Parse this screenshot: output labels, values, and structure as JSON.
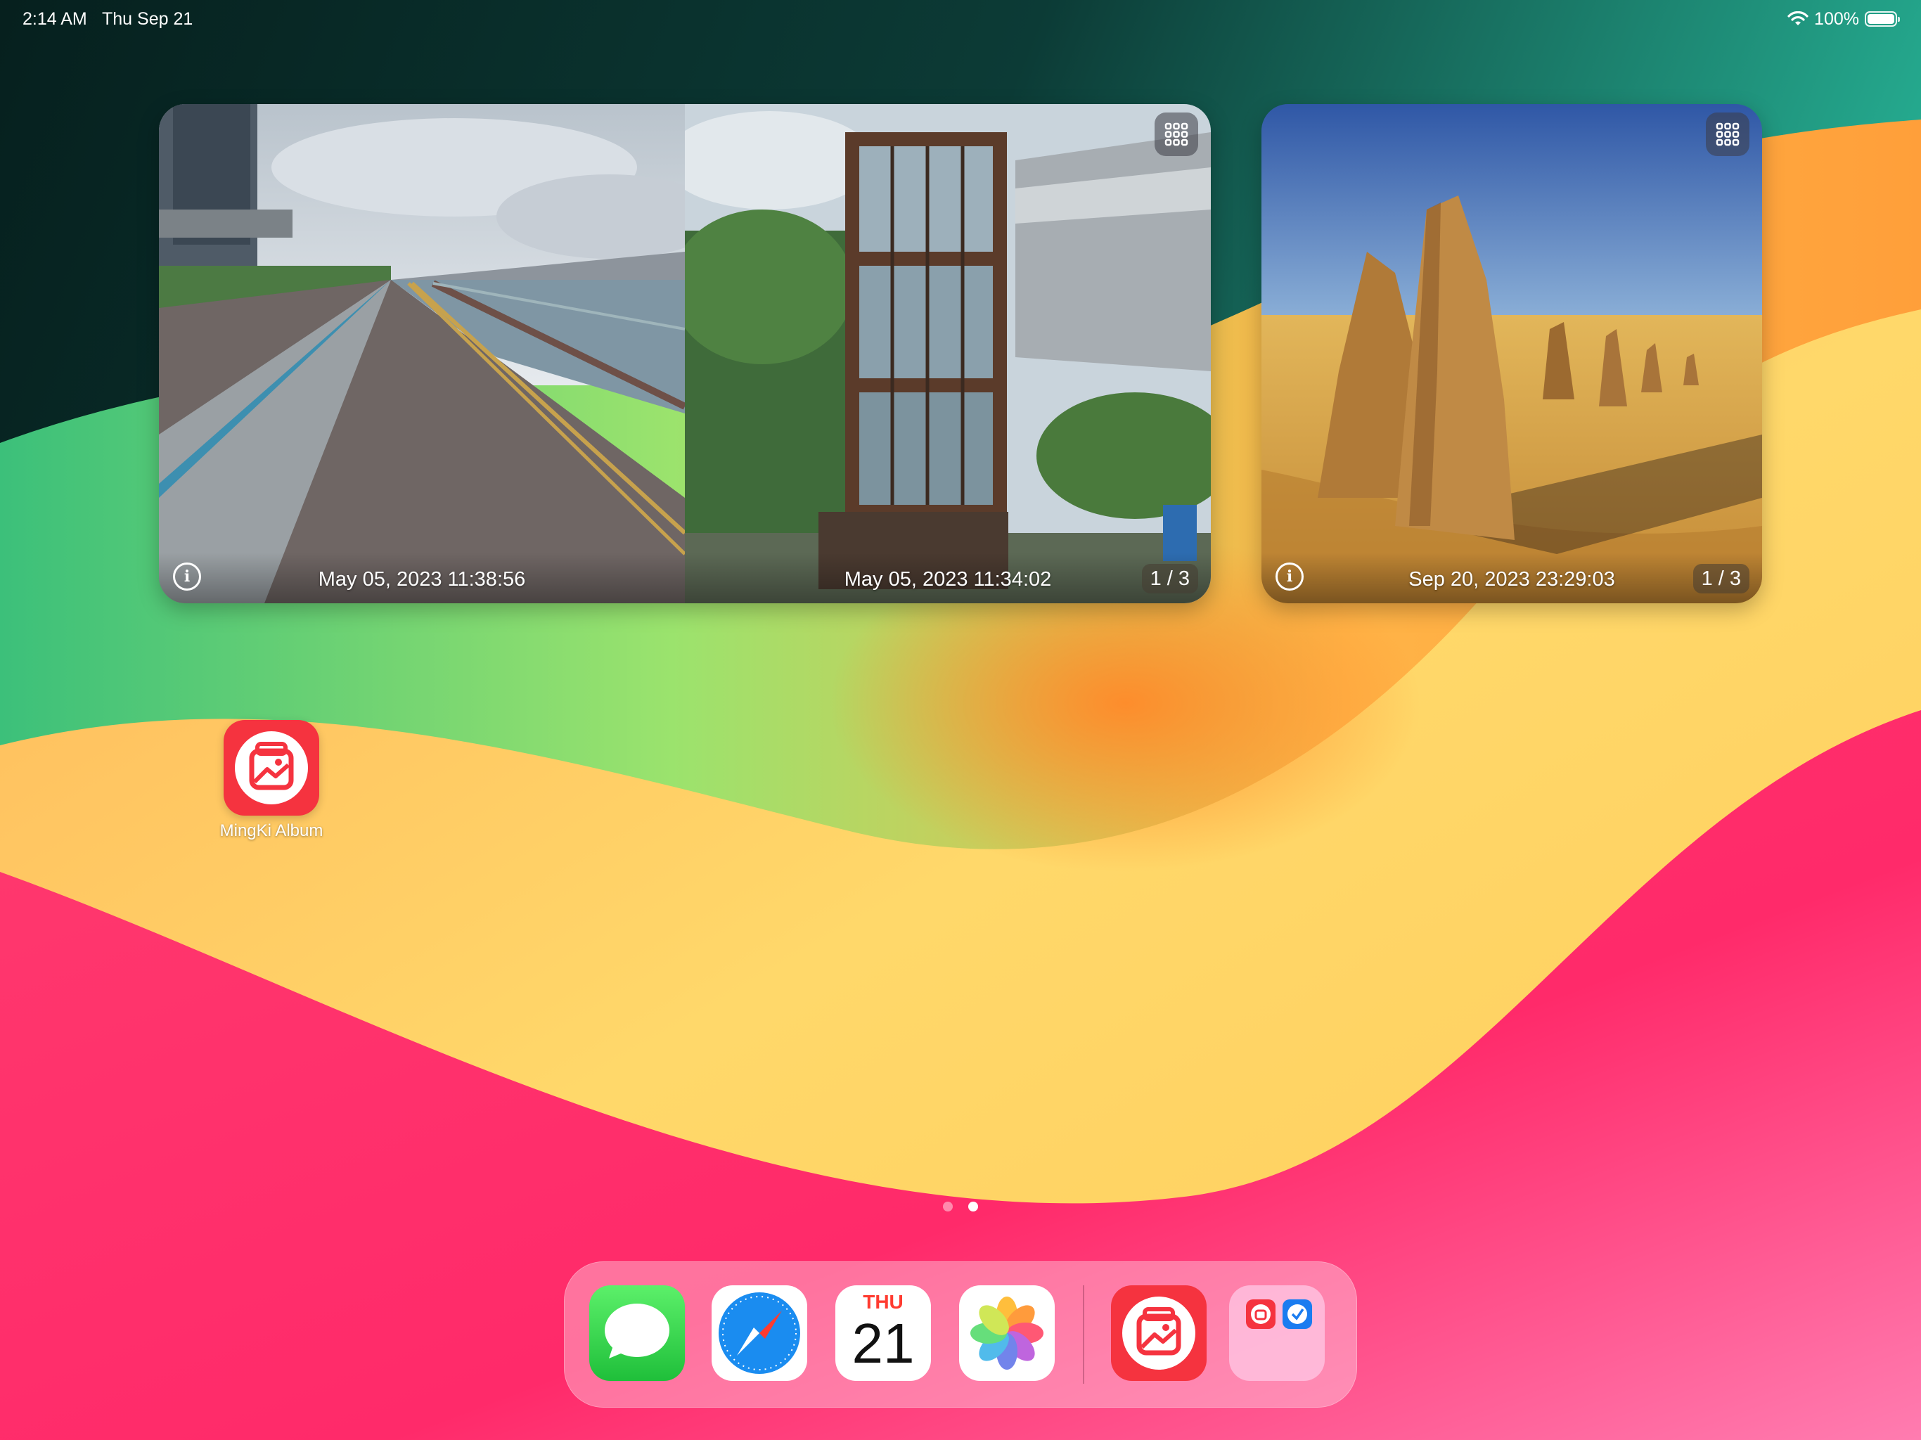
{
  "status_bar": {
    "time": "2:14 AM",
    "date": "Thu Sep 21",
    "battery_percent": "100%",
    "wifi_icon": "wifi-icon",
    "battery_icon": "battery-icon"
  },
  "widgets": {
    "large": {
      "photos": [
        {
          "caption": "May 05, 2023 11:38:56"
        },
        {
          "caption": "May 05, 2023 11:34:02"
        }
      ],
      "counter": "1 / 3"
    },
    "small": {
      "photos": [
        {
          "caption": "Sep 20, 2023 23:29:03"
        }
      ],
      "counter": "1 / 3"
    }
  },
  "home_apps": [
    {
      "name": "MingKi Album",
      "icon": "mingki-album-icon"
    }
  ],
  "page_indicator": {
    "pages": 2,
    "current": 2
  },
  "dock": {
    "apps": [
      {
        "icon": "messages-icon"
      },
      {
        "icon": "safari-icon"
      },
      {
        "icon": "calendar-icon",
        "day": "THU",
        "date": "21"
      },
      {
        "icon": "photos-icon"
      },
      {
        "icon": "mingki-album-icon"
      },
      {
        "icon": "folder-icon"
      }
    ]
  },
  "colors": {
    "app_red": "#f5333f",
    "wallpaper_teal": "#1aa58c",
    "wallpaper_pink": "#ff2d6e",
    "wallpaper_orange": "#ffa63a",
    "wallpaper_green": "#7fe07a"
  }
}
